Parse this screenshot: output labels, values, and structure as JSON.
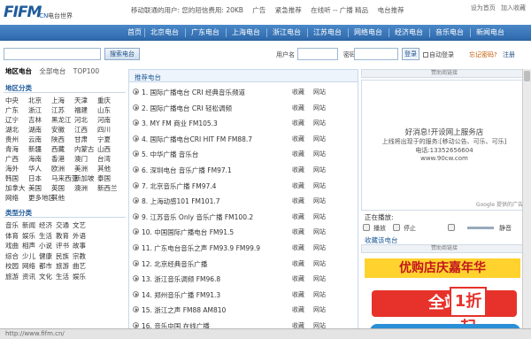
{
  "header": {
    "logo_text": "FIFM",
    "logo_domain": ".CN",
    "logo_subtitle": "电台世界",
    "news": [
      "移动联通的用户: 您的短信费用: 20KB",
      "广告",
      "紧急推荐",
      "在线听 -- 广播 精品",
      "电台推荐"
    ],
    "links": [
      "设为首页",
      "加入收藏"
    ]
  },
  "nav": {
    "items": [
      "首页",
      "北京电台",
      "广东电台",
      "上海电台",
      "浙江电台",
      "江苏电台",
      "网络电台",
      "经济电台",
      "音乐电台",
      "新闻电台"
    ]
  },
  "search": {
    "placeholder": "",
    "button": "搜索电台",
    "user_label": "用户名",
    "pass_label": "密码",
    "login": "登录",
    "remember": "自动登录",
    "forgot": "忘记密码?",
    "register": "注册"
  },
  "left": {
    "tabs": [
      "地区电台",
      "全部电台",
      "TOP100"
    ],
    "region_title": "地区分类",
    "cities": [
      [
        "中央",
        "北京",
        "上海",
        "天津",
        "重庆"
      ],
      [
        "广东",
        "浙江",
        "江苏",
        "福建",
        "山东"
      ],
      [
        "辽宁",
        "吉林",
        "黑龙江",
        "河北",
        "河南"
      ],
      [
        "湖北",
        "湖南",
        "安徽",
        "江西",
        "四川"
      ],
      [
        "贵州",
        "云南",
        "陕西",
        "甘肃",
        "宁夏"
      ],
      [
        "青海",
        "新疆",
        "西藏",
        "内蒙古",
        "山西"
      ],
      [
        "广西",
        "海南",
        "香港",
        "澳门",
        "台湾"
      ],
      [
        "海外",
        "华人",
        "欧洲",
        "美洲",
        "其他"
      ],
      [
        "韩国",
        "日本",
        "马来西亚",
        "新加坡",
        "泰国"
      ],
      [
        "加拿大",
        "美国",
        "英国",
        "澳洲",
        "新西兰"
      ],
      [
        "网络",
        "更多地区",
        "其他"
      ]
    ],
    "category_title": "类型分类",
    "categories": [
      [
        "音乐",
        "新闻",
        "经济",
        "交通",
        "文艺"
      ],
      [
        "体育",
        "娱乐",
        "生活",
        "教育",
        "外语"
      ],
      [
        "戏曲",
        "相声",
        "小说",
        "评书",
        "故事"
      ],
      [
        "综合",
        "少儿",
        "健康",
        "民族",
        "宗教"
      ],
      [
        "校园",
        "网络",
        "都市",
        "旅游",
        "曲艺"
      ],
      [
        "旅游",
        "资讯",
        "文化",
        "生活",
        "娱乐"
      ]
    ]
  },
  "middle": {
    "title": "推荐电台",
    "stations": [
      {
        "name": "1. 国际广播电台 CRI 经典音乐频道",
        "fav": "收藏",
        "web": "网站"
      },
      {
        "name": "2. 国际广播电台 CRI 轻松调频",
        "fav": "收藏",
        "web": "网站"
      },
      {
        "name": "3. MY FM 商业 FM105.3",
        "fav": "收藏",
        "web": "网站"
      },
      {
        "name": "4. 国际广播电台CRI HIT FM FM88.7",
        "fav": "收藏",
        "web": "网站"
      },
      {
        "name": "5. 中华广播 音乐台",
        "fav": "收藏",
        "web": "网站"
      },
      {
        "name": "6. 深圳电台 音乐广播 FM97.1",
        "fav": "收藏",
        "web": "网站"
      },
      {
        "name": "7. 北京音乐广播 FM97.4",
        "fav": "收藏",
        "web": "网站"
      },
      {
        "name": "8. 上海动感101 FM101.7",
        "fav": "收藏",
        "web": "网站"
      },
      {
        "name": "9. 江苏音乐 Only 音乐广播 FM100.2",
        "fav": "收藏",
        "web": "网站"
      },
      {
        "name": "10. 中国国际广播电台 FM91.5",
        "fav": "收藏",
        "web": "网站"
      },
      {
        "name": "11. 广东电台音乐之声 FM93.9 FM99.9",
        "fav": "收藏",
        "web": "网站"
      },
      {
        "name": "12. 北京经典音乐广播",
        "fav": "收藏",
        "web": "网站"
      },
      {
        "name": "13. 浙江音乐调频 FM96.8",
        "fav": "收藏",
        "web": "网站"
      },
      {
        "name": "14. 郑州音乐广播 FM91.3",
        "fav": "收藏",
        "web": "网站"
      },
      {
        "name": "15. 浙江之声 FM88 AM810",
        "fav": "收藏",
        "web": "网站"
      },
      {
        "name": "16. 音乐中国 在线广播",
        "fav": "收藏",
        "web": "网站"
      }
    ]
  },
  "right": {
    "ad_head": "赞助商链接",
    "ad_lines": [
      "好消息!开设网上服务店",
      "上线将出现于的服务:[移动公告、可乐、可乐]",
      "电话:13352656604",
      "www.90cw.com",
      ""
    ],
    "google": "Google 提供的广告",
    "player_title": "正在播放:",
    "player_controls": [
      "播放",
      "停止",
      "静音"
    ],
    "player_link": "收藏该电台",
    "banner_head": "赞助商链接",
    "banner_text1": "优购店庆嘉年华",
    "banner_text2": "全站",
    "banner_text3": "1折起"
  },
  "status": {
    "text": "http://www.fifm.cn/"
  }
}
